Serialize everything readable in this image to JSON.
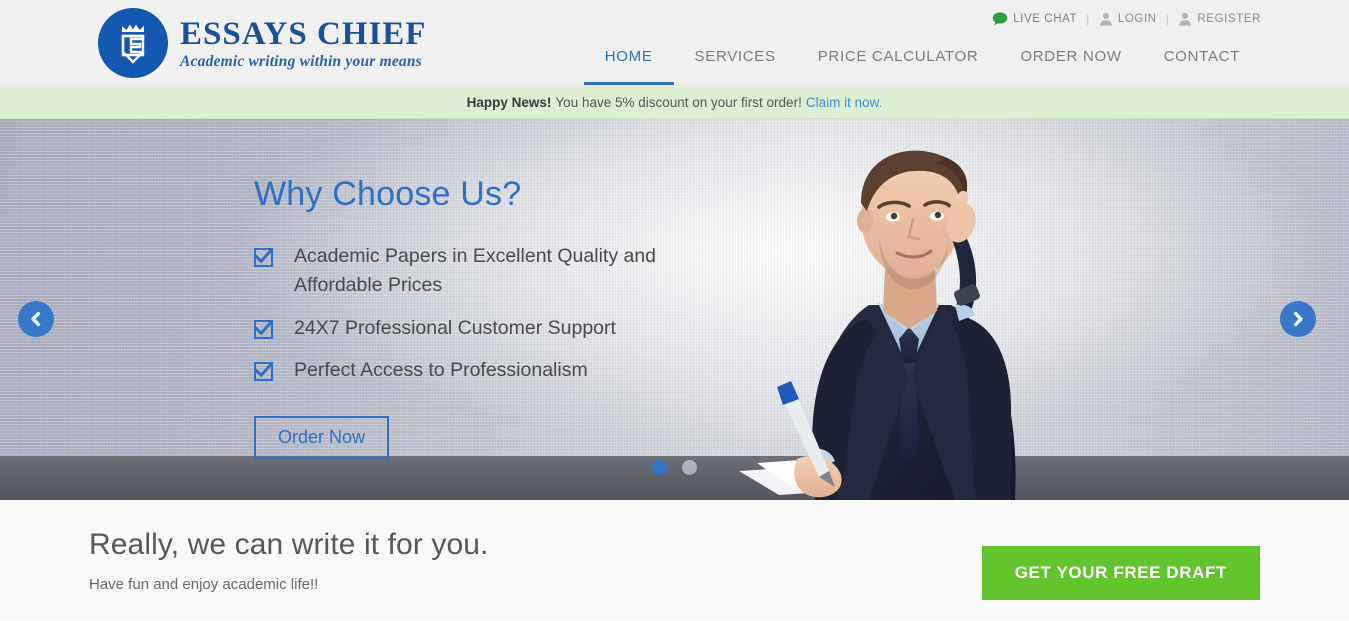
{
  "brand": {
    "name": "ESSAYS CHIEF",
    "tagline": "Academic writing within your means",
    "logo_icon": "crown-shield-logo",
    "logo_color": "#1257b0",
    "name_color": "#1a4f9c"
  },
  "utility_nav": {
    "separator": "|",
    "items": [
      {
        "label": "LIVE CHAT",
        "icon": "speech-bubble-icon",
        "icon_color": "#2e9b3f"
      },
      {
        "label": "LOGIN",
        "icon": "user-icon",
        "icon_color": "#b5b5b5"
      },
      {
        "label": "REGISTER",
        "icon": "user-icon",
        "icon_color": "#b5b5b5"
      }
    ]
  },
  "main_nav": {
    "accent_color": "#2f6fc4",
    "items": [
      {
        "label": "HOME",
        "active": true
      },
      {
        "label": "SERVICES",
        "active": false
      },
      {
        "label": "PRICE CALCULATOR",
        "active": false
      },
      {
        "label": "ORDER NOW",
        "active": false
      },
      {
        "label": "CONTACT",
        "active": false
      }
    ]
  },
  "announcement": {
    "bold_text": "Happy News!",
    "message": "You have 5% discount on your first order!",
    "link_text": "Claim it now.",
    "background": "#ddeed2",
    "link_color": "#3a8fd6"
  },
  "hero": {
    "title": "Why Choose Us?",
    "title_color": "#2f6fc4",
    "bullets": [
      "Academic Papers in Excellent Quality and Affordable Prices",
      "24X7 Professional Customer Support",
      "Perfect Access to Professionalism"
    ],
    "order_button": "Order Now",
    "prev_arrow_icon": "chevron-left-icon",
    "next_arrow_icon": "chevron-right-icon",
    "arrow_color": "#3878c8",
    "image_alt": "thoughtful-businessman-writing-at-desk",
    "slides": [
      {
        "active": true
      },
      {
        "active": false
      }
    ]
  },
  "cta": {
    "title": "Really, we can write it for you.",
    "subtitle": "Have fun and enjoy academic life!!",
    "button_label": "GET YOUR FREE DRAFT",
    "button_color": "#63c52e"
  }
}
